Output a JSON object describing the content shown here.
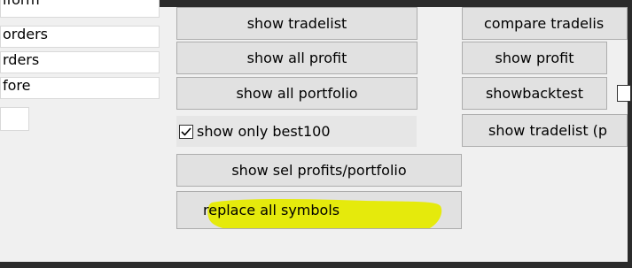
{
  "left_list": {
    "clipped_top_text": "iform",
    "items": [
      "orders",
      "rders",
      "fore"
    ]
  },
  "buttons": {
    "show_tradelist": "show tradelist",
    "show_all_profit": "show all profit",
    "show_all_portfolio": "show all portfolio",
    "show_sel_profits_portfolio": "show sel profits/portfolio",
    "replace_all_symbols": "replace all symbols",
    "compare_tradelist": "compare tradelis",
    "show_profit": "show profit",
    "showbacktest": "showbacktest",
    "show_tradelist_p": "show tradelist (p"
  },
  "checkbox": {
    "label": "show only best100",
    "checked": true
  },
  "colors": {
    "highlight": "#e5ea00",
    "button_bg": "#e1e1e1",
    "window_bg": "#f0f0f0"
  }
}
